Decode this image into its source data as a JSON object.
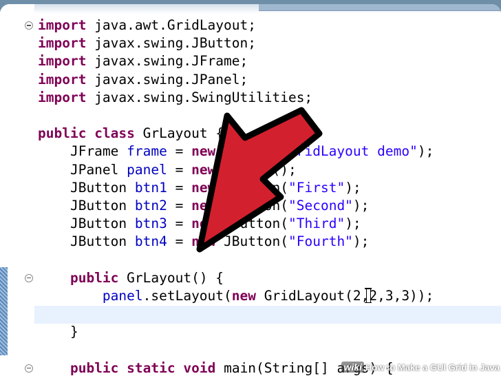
{
  "editor": {
    "lines": [
      [
        {
          "t": "import",
          "c": "kw"
        },
        {
          "t": " java.awt.GridLayout;"
        }
      ],
      [
        {
          "t": "import",
          "c": "kw"
        },
        {
          "t": " javax.swing.JButton;"
        }
      ],
      [
        {
          "t": "import",
          "c": "kw"
        },
        {
          "t": " javax.swing.JFrame;"
        }
      ],
      [
        {
          "t": "import",
          "c": "kw"
        },
        {
          "t": " javax.swing.JPanel;"
        }
      ],
      [
        {
          "t": "import",
          "c": "kw"
        },
        {
          "t": " javax.swing.SwingUtilities;"
        }
      ],
      [],
      [
        {
          "t": "public",
          "c": "kw"
        },
        {
          "t": " "
        },
        {
          "t": "class",
          "c": "kw"
        },
        {
          "t": " GrLayout {"
        }
      ],
      [
        {
          "t": "    JFrame "
        },
        {
          "t": "frame",
          "c": "fld"
        },
        {
          "t": " = "
        },
        {
          "t": "new",
          "c": "kw"
        },
        {
          "t": " JFrame("
        },
        {
          "t": "\"GridLayout demo\"",
          "c": "str"
        },
        {
          "t": ");"
        }
      ],
      [
        {
          "t": "    JPanel "
        },
        {
          "t": "panel",
          "c": "fld"
        },
        {
          "t": " = "
        },
        {
          "t": "new",
          "c": "kw"
        },
        {
          "t": " JPanel();"
        }
      ],
      [
        {
          "t": "    JButton "
        },
        {
          "t": "btn1",
          "c": "fld"
        },
        {
          "t": " = "
        },
        {
          "t": "new",
          "c": "kw"
        },
        {
          "t": " JButton("
        },
        {
          "t": "\"First\"",
          "c": "str"
        },
        {
          "t": ");"
        }
      ],
      [
        {
          "t": "    JButton "
        },
        {
          "t": "btn2",
          "c": "fld"
        },
        {
          "t": " = "
        },
        {
          "t": "new",
          "c": "kw"
        },
        {
          "t": " JButton("
        },
        {
          "t": "\"Second\"",
          "c": "str"
        },
        {
          "t": ");"
        }
      ],
      [
        {
          "t": "    JButton "
        },
        {
          "t": "btn3",
          "c": "fld"
        },
        {
          "t": " = "
        },
        {
          "t": "new",
          "c": "kw"
        },
        {
          "t": " JButton("
        },
        {
          "t": "\"Third\"",
          "c": "str"
        },
        {
          "t": ");"
        }
      ],
      [
        {
          "t": "    JButton "
        },
        {
          "t": "btn4",
          "c": "fld"
        },
        {
          "t": " = "
        },
        {
          "t": "new",
          "c": "kw"
        },
        {
          "t": " JButton("
        },
        {
          "t": "\"Fourth\"",
          "c": "str"
        },
        {
          "t": ");"
        }
      ],
      [],
      [
        {
          "t": "    "
        },
        {
          "t": "public",
          "c": "kw"
        },
        {
          "t": " GrLayout() {"
        }
      ],
      [
        {
          "t": "        "
        },
        {
          "t": "panel",
          "c": "fld"
        },
        {
          "t": ".setLayout("
        },
        {
          "t": "new",
          "c": "kw"
        },
        {
          "t": " GridLayout(2,2,3,3));"
        }
      ],
      [],
      [
        {
          "t": "    }"
        }
      ],
      [],
      [
        {
          "t": "    "
        },
        {
          "t": "public",
          "c": "kw"
        },
        {
          "t": " "
        },
        {
          "t": "static",
          "c": "kw"
        },
        {
          "t": " "
        },
        {
          "t": "void",
          "c": "kw"
        },
        {
          "t": " main(String[] args) {"
        }
      ]
    ],
    "fold_lines": [
      0,
      14,
      19
    ]
  },
  "watermark": {
    "logo": "wiki",
    "logo_bold": "How",
    "text": "How to Make a GUI Grid in Java"
  },
  "colors": {
    "keyword": "#7f0055",
    "field": "#0000c0",
    "string": "#2a00ff",
    "arrow": "#d3202e",
    "current_line": "#e8f2fe"
  }
}
